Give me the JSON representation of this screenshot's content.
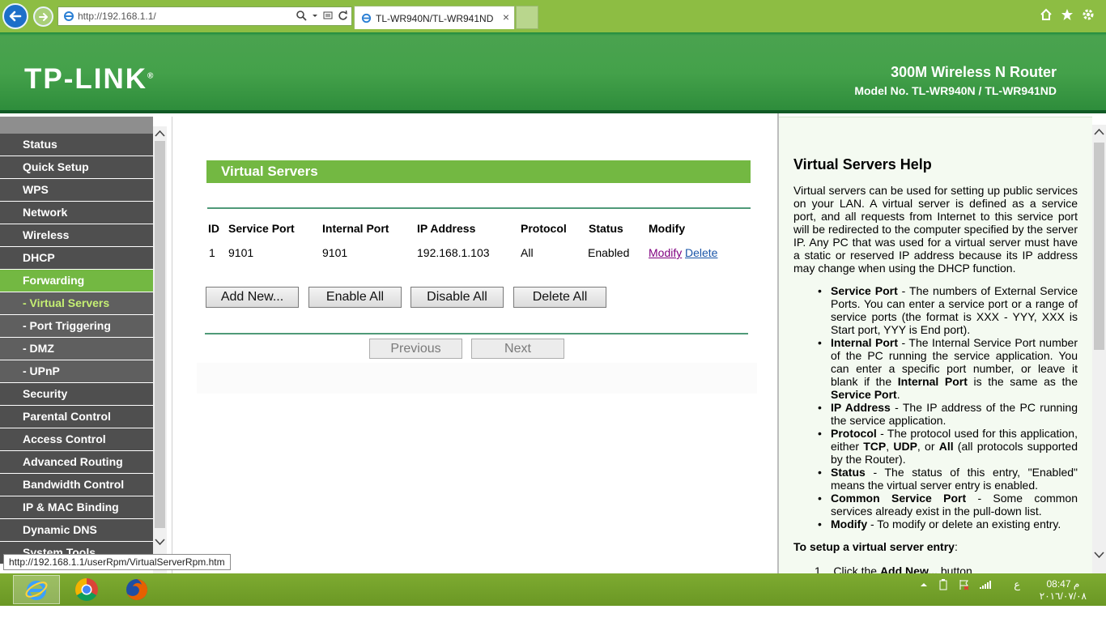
{
  "browser": {
    "url": "http://192.168.1.1/",
    "tab_title": "TL-WR940N/TL-WR941ND",
    "tab_close": "×"
  },
  "banner": {
    "logo": "TP-LINK",
    "logo_reg": "®",
    "product": "300M Wireless N Router",
    "model": "Model No. TL-WR940N / TL-WR941ND"
  },
  "menu": {
    "items": [
      {
        "label": "Status",
        "type": "main"
      },
      {
        "label": "Quick Setup",
        "type": "main"
      },
      {
        "label": "WPS",
        "type": "main"
      },
      {
        "label": "Network",
        "type": "main"
      },
      {
        "label": "Wireless",
        "type": "main"
      },
      {
        "label": "DHCP",
        "type": "main"
      },
      {
        "label": "Forwarding",
        "type": "main",
        "state": "active"
      },
      {
        "label": "- Virtual Servers",
        "type": "sub",
        "state": "active"
      },
      {
        "label": "- Port Triggering",
        "type": "sub"
      },
      {
        "label": "- DMZ",
        "type": "sub"
      },
      {
        "label": "- UPnP",
        "type": "sub"
      },
      {
        "label": "Security",
        "type": "main"
      },
      {
        "label": "Parental Control",
        "type": "main"
      },
      {
        "label": "Access Control",
        "type": "main"
      },
      {
        "label": "Advanced Routing",
        "type": "main"
      },
      {
        "label": "Bandwidth Control",
        "type": "main"
      },
      {
        "label": "IP & MAC Binding",
        "type": "main"
      },
      {
        "label": "Dynamic DNS",
        "type": "main"
      },
      {
        "label": "System Tools",
        "type": "main"
      }
    ]
  },
  "main": {
    "title": "Virtual Servers",
    "table": {
      "headers": [
        "ID",
        "Service Port",
        "Internal Port",
        "IP Address",
        "Protocol",
        "Status",
        "Modify"
      ],
      "rows": [
        {
          "id": "1",
          "service_port": "9101",
          "internal_port": "9101",
          "ip": "192.168.1.103",
          "protocol": "All",
          "status": "Enabled",
          "modify": "Modify",
          "delete": "Delete"
        }
      ]
    },
    "buttons": {
      "add_new": "Add New...",
      "enable_all": "Enable All",
      "disable_all": "Disable All",
      "delete_all": "Delete All",
      "previous": "Previous",
      "next": "Next"
    }
  },
  "help": {
    "title": "Virtual Servers Help",
    "intro": "Virtual servers can be used for setting up public services on your LAN. A virtual server is defined as a service port, and all requests from Internet to this service port will be redirected to the computer specified by the server IP. Any PC that was used for a virtual server must have a static or reserved IP address because its IP address may change when using the DHCP function.",
    "items": [
      {
        "term": "Service Port",
        "text": " - The numbers of External Service Ports. You can enter a service port or a range of service ports (the format is XXX - YYY, XXX is Start port, YYY is End port)."
      },
      {
        "term": "Internal Port",
        "text": " - The Internal Service Port number of the PC running the service application. You can enter a specific port number, or leave it blank if the ",
        "term2": "Internal Port",
        "text2": " is the same as the ",
        "term3": "Service Port",
        "text3": "."
      },
      {
        "term": "IP Address",
        "text": " - The IP address of the PC running the service application."
      },
      {
        "term": "Protocol",
        "text": " - The protocol used for this application, either ",
        "term2": "TCP",
        "text2": ", ",
        "term3": "UDP",
        "text3": ", or ",
        "term4": "All",
        "text4": " (all protocols supported by the Router)."
      },
      {
        "term": "Status",
        "text": " - The status of this entry, \"Enabled\" means the virtual server entry is enabled."
      },
      {
        "term": "Common Service Port",
        "text": " - Some common services already exist in the pull-down list."
      },
      {
        "term": "Modify",
        "text": " - To modify or delete an existing entry."
      }
    ],
    "setup_title": "To setup a virtual server entry",
    "setup_colon": ":",
    "step1_num": "1.",
    "step1_a": "Click the ",
    "step1_b": "Add New...",
    "step1_c": " button."
  },
  "statusbar": {
    "url": "http://192.168.1.1/userRpm/VirtualServerRpm.htm"
  },
  "taskbar": {
    "lang": "ع",
    "time": "08:47 م",
    "date": "٢٠١٦/٠٧/٠٨"
  },
  "colors": {
    "tplink_green": "#44a14a",
    "menu_active": "#73b842",
    "menu_bg": "#4f4f4f",
    "link_visited": "#800080",
    "link": "#1a55a8"
  }
}
